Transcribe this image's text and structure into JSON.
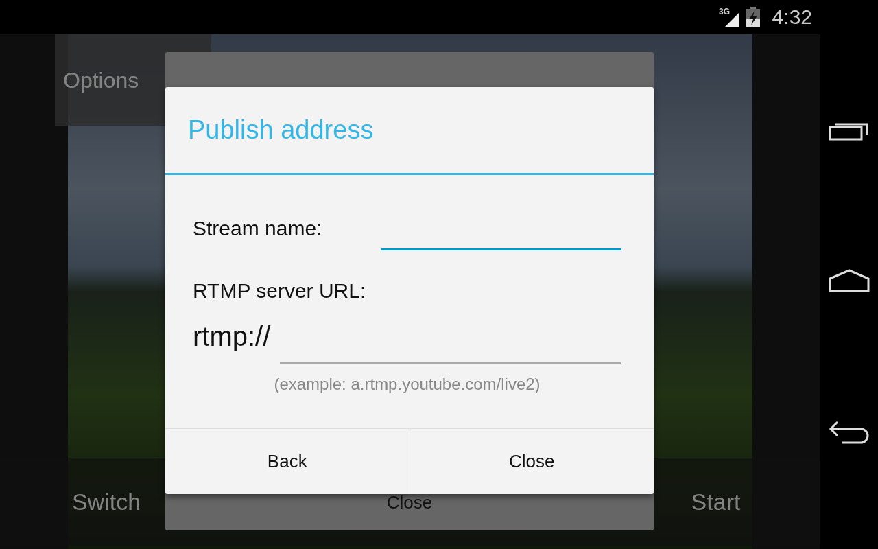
{
  "status_bar": {
    "network": "3G",
    "time": "4:32"
  },
  "camera_screen": {
    "options_button": "Options",
    "switch_button": "Switch",
    "start_button": "Start"
  },
  "background_dialog": {
    "button": "Close"
  },
  "dialog": {
    "title": "Publish address",
    "fields": [
      {
        "label": "Stream name:",
        "focused": true
      },
      {
        "label": "RTMP server URL:",
        "prefix": "rtmp://",
        "focused": false,
        "hint": "(example: a.rtmp.youtube.com/live2)"
      }
    ],
    "buttons": [
      "Back",
      "Close"
    ]
  }
}
